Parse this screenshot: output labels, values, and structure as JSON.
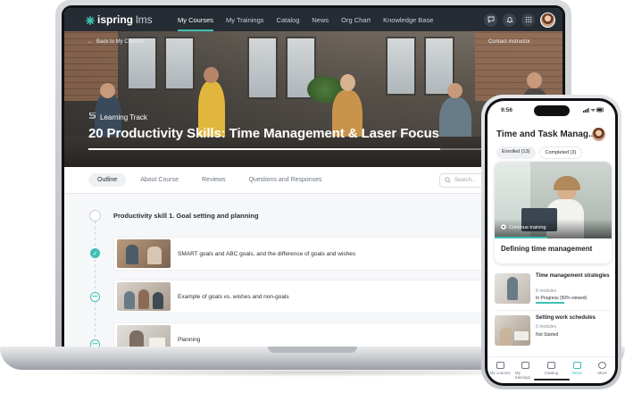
{
  "colors": {
    "accent": "#3fbfb4",
    "nav_bg": "#262c33"
  },
  "laptop": {
    "nav": {
      "logo_word": "ispring",
      "logo_suffix": "lms",
      "links": [
        "My Courses",
        "My Trainings",
        "Catalog",
        "News",
        "Org Chart",
        "Knowledge Base"
      ],
      "active_link": "My Courses",
      "icons": [
        "chat-icon",
        "bell-icon",
        "apps-grid-icon",
        "user-avatar"
      ]
    },
    "hero": {
      "back_link": "Back to My Courses",
      "contact_link": "Contact instructor",
      "track_label": "Learning Track",
      "title": "20 Productivity Skills: Time Management & Laser Focus",
      "progress_fraction": 0.82
    },
    "tabs": [
      "Outline",
      "About Course",
      "Reviews",
      "Questions and Responses"
    ],
    "active_tab": "Outline",
    "search": {
      "placeholder": "Search..."
    },
    "section": {
      "title": "Productivity skill 1. Goal setting and planning"
    },
    "lessons": [
      {
        "title": "SMART goals and ABC goals, and the difference of goals and wishes",
        "status": "completed"
      },
      {
        "title": "Example of goals vs. wishes and non-goals",
        "status": "in-progress"
      },
      {
        "title": "Planning",
        "status": "in-progress"
      }
    ]
  },
  "phone": {
    "time": "9:56",
    "title": "Time and Task Manag...",
    "chips": [
      "Enrolled (13)",
      "Completed (3)"
    ],
    "card": {
      "continue_label": "Continue training",
      "title": "Defining time management"
    },
    "items": [
      {
        "title": "Time management strategies",
        "modules": "8 modules",
        "status": "In Progress (50% viewed)"
      },
      {
        "title": "Setting work schedules",
        "modules": "5 modules",
        "status": "Not Started"
      }
    ],
    "tabbar": [
      "My courses",
      "My trainings",
      "Catalog",
      "News",
      "More"
    ],
    "active_tab": "News"
  }
}
